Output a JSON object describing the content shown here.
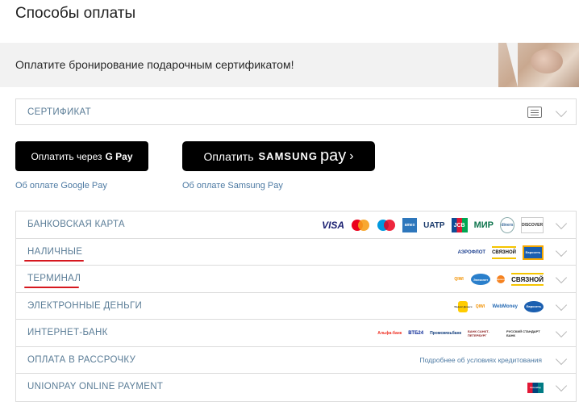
{
  "page": {
    "title": "Способы оплаты"
  },
  "banner": {
    "text": "Оплатите бронирование подарочным сертификатом!"
  },
  "certificate": {
    "label": "СЕРТИФИКАТ"
  },
  "wallets": {
    "gpay_prefix": "Оплатить через",
    "gpay_brand": "G Pay",
    "gpay_link": "Об оплате Google Pay",
    "spay_prefix": "Оплатить",
    "spay_brand": "SAMSUNG",
    "spay_pay": "pay",
    "spay_arrow": "›",
    "spay_link": "Об оплате Samsung Pay"
  },
  "methods": [
    {
      "label": "БАНКОВСКАЯ КАРТА",
      "logos": [
        "VISA",
        "mastercard",
        "maestro",
        "amex",
        "UATP",
        "JCB",
        "МИР",
        "diners",
        "DISCOVER"
      ]
    },
    {
      "label": "НАЛИЧНЫЕ",
      "logos": [
        "АЭРОФЛОТ",
        "СВЯЗНОЙ",
        "Евросеть"
      ]
    },
    {
      "label": "ТЕРМИНАЛ",
      "logos": [
        "QIWI",
        "Элекснет",
        "Евросеть",
        "СВЯЗНОЙ"
      ]
    },
    {
      "label": "ЭЛЕКТРОННЫЕ ДЕНЬГИ",
      "logos": [
        "Яндекс.Деньги",
        "QIWI",
        "WebMoney",
        "Евросеть"
      ]
    },
    {
      "label": "ИНТЕРНЕТ-БАНК",
      "logos": [
        "Альфа-банк",
        "ВТБ24",
        "Промсвязьбанк",
        "БАНК САНКТ-ПЕТЕРБУРГ",
        "РУССКИЙ СТАНДАРТ БАНК"
      ]
    },
    {
      "label": "ОПЛАТА В РАССРОЧКУ",
      "note": "Подробнее об условиях кредитования"
    },
    {
      "label": "UNIONPAY ONLINE PAYMENT",
      "logos": [
        "UnionPay"
      ]
    }
  ],
  "colors": {
    "accent_link": "#4d7aa3",
    "label": "#5b7d97",
    "underline": "#d6181f"
  }
}
